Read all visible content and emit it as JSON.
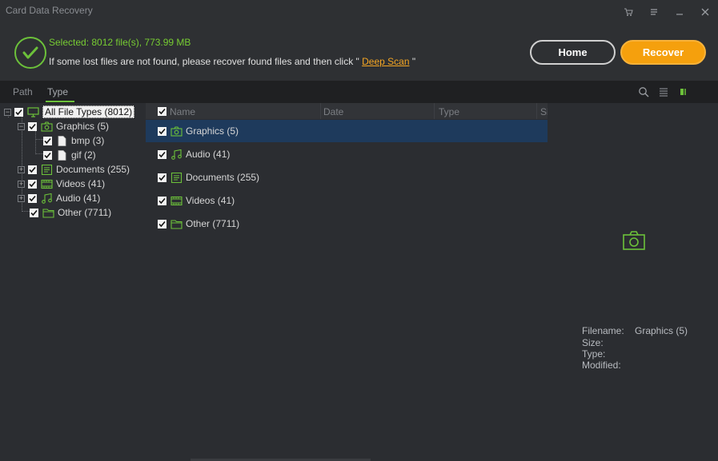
{
  "app": {
    "title": "Card Data Recovery"
  },
  "status": {
    "selected": "Selected: 8012 file(s), 773.99 MB",
    "hint_prefix": "If some lost files are not found, please recover found files and then click \" ",
    "deep_scan": "Deep Scan",
    "hint_suffix": " \""
  },
  "buttons": {
    "home": "Home",
    "recover": "Recover"
  },
  "tabs": {
    "path": "Path",
    "type": "Type",
    "active": "Type"
  },
  "tree": {
    "root": "All File Types (8012)",
    "graphics": "Graphics (5)",
    "bmp": "bmp (3)",
    "gif": "gif (2)",
    "documents": "Documents (255)",
    "videos": "Videos (41)",
    "audio": "Audio (41)",
    "other": "Other (7711)"
  },
  "list": {
    "columns": {
      "name": "Name",
      "date": "Date",
      "type": "Type",
      "size": "Si"
    },
    "rows": [
      "Graphics (5)",
      "Audio (41)",
      "Documents (255)",
      "Videos (41)",
      "Other (7711)"
    ],
    "selected": "Graphics (5)"
  },
  "preview": {
    "filename_label": "Filename:",
    "filename_value": "Graphics (5)",
    "size_label": "Size:",
    "type_label": "Type:",
    "modified_label": "Modified:"
  },
  "colors": {
    "accent_green": "#6cc13a",
    "recover_orange": "#f5a00d",
    "selected_row": "#1e3a5c"
  },
  "icons": [
    "cart-icon",
    "menu-icon",
    "minimize-icon",
    "close-icon",
    "check-circle-icon",
    "search-icon",
    "list-view-icon",
    "preview-view-icon",
    "monitor-icon",
    "camera-icon",
    "file-icon",
    "document-icon",
    "video-icon",
    "music-icon",
    "folder-icon"
  ]
}
